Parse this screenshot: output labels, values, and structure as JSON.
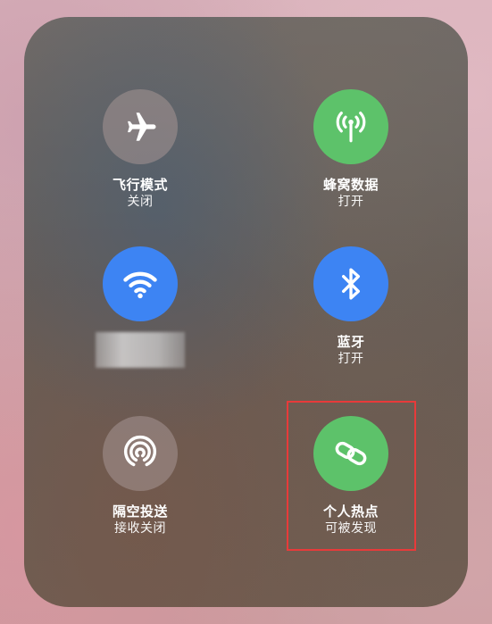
{
  "controls": {
    "airplane": {
      "title": "飞行模式",
      "status": "关闭",
      "icon": "airplane-icon",
      "state": "off"
    },
    "cellular": {
      "title": "蜂窝数据",
      "status": "打开",
      "icon": "antenna-icon",
      "state": "on"
    },
    "wifi": {
      "title": "",
      "status": "",
      "icon": "wifi-icon",
      "state": "on",
      "network_name_redacted": true
    },
    "bluetooth": {
      "title": "蓝牙",
      "status": "打开",
      "icon": "bluetooth-icon",
      "state": "on"
    },
    "airdrop": {
      "title": "隔空投送",
      "status": "接收关闭",
      "icon": "airdrop-icon",
      "state": "off"
    },
    "hotspot": {
      "title": "个人热点",
      "status": "可被发现",
      "icon": "hotspot-link-icon",
      "state": "on"
    }
  },
  "colors": {
    "green": "#5dc26a",
    "blue": "#3d84f3",
    "off": "#a5969480",
    "highlight": "#e83a3a"
  }
}
